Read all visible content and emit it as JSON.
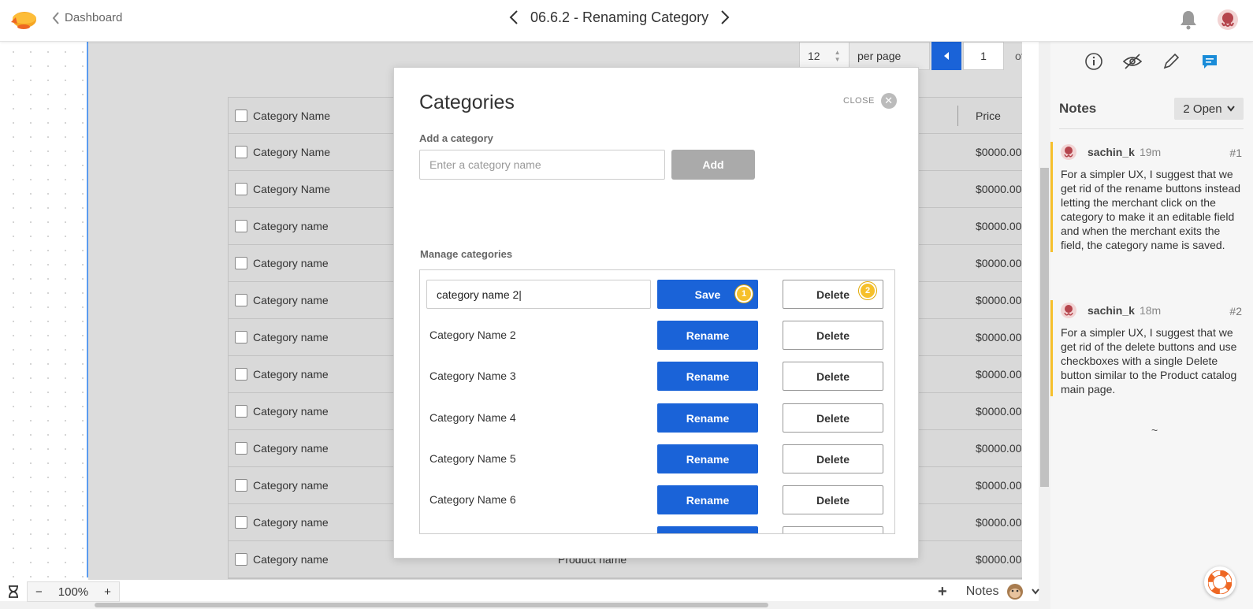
{
  "header": {
    "back_label": "Dashboard",
    "screen_title": "06.6.2 - Renaming Category"
  },
  "pager": {
    "count": "12",
    "per_page": "per page",
    "page": "1",
    "of": "of"
  },
  "product_table": {
    "header": {
      "name": "Category Name",
      "price": "Price"
    },
    "rows": [
      {
        "name": "Category Name",
        "price": "$0000.00"
      },
      {
        "name": "Category Name",
        "price": "$0000.00"
      },
      {
        "name": "Category name",
        "price": "$0000.00"
      },
      {
        "name": "Category name",
        "price": "$0000.00"
      },
      {
        "name": "Category name",
        "price": "$0000.00"
      },
      {
        "name": "Category name",
        "price": "$0000.00"
      },
      {
        "name": "Category name",
        "price": "$0000.00"
      },
      {
        "name": "Category name",
        "price": "$0000.00"
      },
      {
        "name": "Category name",
        "price": "$0000.00"
      },
      {
        "name": "Category name",
        "price": "$0000.00"
      },
      {
        "name": "Category name",
        "price": "$0000.00"
      },
      {
        "name": "Category name",
        "product": "Product name",
        "price": "$0000.00"
      }
    ]
  },
  "modal": {
    "title": "Categories",
    "close_label": "CLOSE",
    "add_label": "Add a category",
    "add_placeholder": "Enter a category name",
    "add_button": "Add",
    "manage_label": "Manage categories",
    "editing": {
      "value": "category name 2|",
      "save": "Save",
      "delete": "Delete",
      "pin1": "1",
      "pin2": "2"
    },
    "categories": [
      {
        "name": "Category Name 2",
        "rename": "Rename",
        "delete": "Delete"
      },
      {
        "name": "Category Name 3",
        "rename": "Rename",
        "delete": "Delete"
      },
      {
        "name": "Category Name 4",
        "rename": "Rename",
        "delete": "Delete"
      },
      {
        "name": "Category Name 5",
        "rename": "Rename",
        "delete": "Delete"
      },
      {
        "name": "Category Name 6",
        "rename": "Rename",
        "delete": "Delete"
      }
    ]
  },
  "zoom": {
    "minus": "−",
    "level": "100%",
    "plus": "+"
  },
  "notes_toolbar": {
    "plus": "+",
    "label": "Notes"
  },
  "sidebar": {
    "title": "Notes",
    "filter": "2 Open",
    "notes": [
      {
        "user": "sachin_k",
        "time": "19m",
        "num": "#1",
        "text": "For a simpler UX, I suggest that we get rid of the rename buttons instead letting the merchant click on the category to make it an editable field and when the merchant exits the field, the category name is saved."
      },
      {
        "user": "sachin_k",
        "time": "18m",
        "num": "#2",
        "text": "For a simpler UX, I suggest that we get rid of the delete buttons and use checkboxes with a single Delete button similar to the Product catalog main page."
      }
    ],
    "end_mark": "~"
  },
  "colors": {
    "accent": "#1a63d8",
    "pin": "#f6c02b"
  },
  "icons": [
    "zeplin-logo-icon",
    "chevron-left-icon",
    "chevron-right-icon",
    "bell-icon",
    "avatar-icon",
    "info-icon",
    "eye-off-icon",
    "pen-icon",
    "comment-icon",
    "chevron-down-icon",
    "help-icon",
    "hourglass-icon"
  ]
}
